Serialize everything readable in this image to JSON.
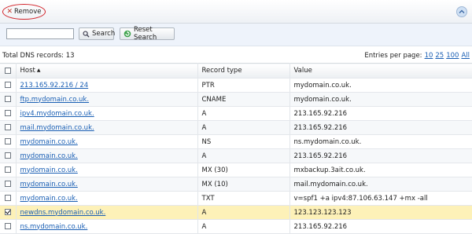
{
  "toolbar": {
    "remove_label": "Remove"
  },
  "search": {
    "value": "",
    "placeholder": "",
    "search_label": "Search",
    "reset_label": "Reset Search"
  },
  "summary": {
    "total_label": "Total DNS records: 13",
    "entries_label": "Entries per page:",
    "page_sizes": [
      "10",
      "25",
      "100",
      "All"
    ]
  },
  "table": {
    "columns": [
      "Host",
      "Record type",
      "Value"
    ],
    "sort_indicator": "▲",
    "rows": [
      {
        "host": "213.165.92.216 / 24",
        "type": "PTR",
        "value": "mydomain.co.uk.",
        "checked": false
      },
      {
        "host": "ftp.mydomain.co.uk.",
        "type": "CNAME",
        "value": "mydomain.co.uk.",
        "checked": false
      },
      {
        "host": "ipv4.mydomain.co.uk.",
        "type": "A",
        "value": "213.165.92.216",
        "checked": false
      },
      {
        "host": "mail.mydomain.co.uk.",
        "type": "A",
        "value": "213.165.92.216",
        "checked": false
      },
      {
        "host": "mydomain.co.uk.",
        "type": "NS",
        "value": "ns.mydomain.co.uk.",
        "checked": false
      },
      {
        "host": "mydomain.co.uk.",
        "type": "A",
        "value": "213.165.92.216",
        "checked": false
      },
      {
        "host": "mydomain.co.uk.",
        "type": "MX (30)",
        "value": "mxbackup.3ait.co.uk.",
        "checked": false
      },
      {
        "host": "mydomain.co.uk.",
        "type": "MX (10)",
        "value": "mail.mydomain.co.uk.",
        "checked": false
      },
      {
        "host": "mydomain.co.uk.",
        "type": "TXT",
        "value": "v=spf1 +a ipv4:87.106.63.147 +mx -all",
        "checked": false
      },
      {
        "host": "newdns.mydomain.co.uk.",
        "type": "A",
        "value": "123.123.123.123",
        "checked": true
      },
      {
        "host": "ns.mydomain.co.uk.",
        "type": "A",
        "value": "213.165.92.216",
        "checked": false
      }
    ]
  },
  "colors": {
    "link": "#1a5fb4",
    "highlight_ring": "#d2232a",
    "selected_row": "#fdf1b8"
  }
}
